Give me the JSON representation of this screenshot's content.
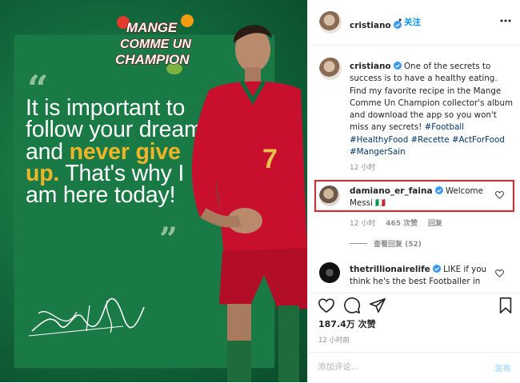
{
  "post_image": {
    "brand": {
      "line1": "MANGE",
      "line2": "COMME UN",
      "line3": "CHAMPION"
    },
    "quote": {
      "part1": "It is important to follow your dream and ",
      "highlight": "never give up.",
      "part2": " That's why I am here today!"
    },
    "jersey_number": "7",
    "colors": {
      "bg_green": "#1a7a45",
      "highlight_yellow": "#f0b429",
      "jersey_red": "#c8102e"
    }
  },
  "header": {
    "username": "cristiano",
    "follow_label": "关注"
  },
  "caption": {
    "username": "cristiano",
    "text": "One of the secrets to success is to have a healthy eating. Find my favorite recipe in the Mange Comme Un Champion collector's album and download the app so you won't miss any secrets!",
    "hashtags": [
      "#Football",
      "#HealthyFood",
      "#Recette",
      "#ActForFood",
      "#MangerSain"
    ],
    "time": "12 小时"
  },
  "comments": [
    {
      "username": "damiano_er_faina",
      "text": "Welcome Messi",
      "flag": "🇮🇹",
      "time": "12 小时",
      "likes": "465 次赞",
      "reply_label": "回复",
      "view_replies": "查看回复 (52)",
      "highlighted": true
    },
    {
      "username": "thetrillionairelife",
      "text": "LIKE if you think he's the best Footballer in"
    }
  ],
  "actions": {
    "likes": "187.4万 次赞",
    "time": "12 小时前"
  },
  "add_comment": {
    "placeholder": "添加评论...",
    "post_label": "发布"
  }
}
